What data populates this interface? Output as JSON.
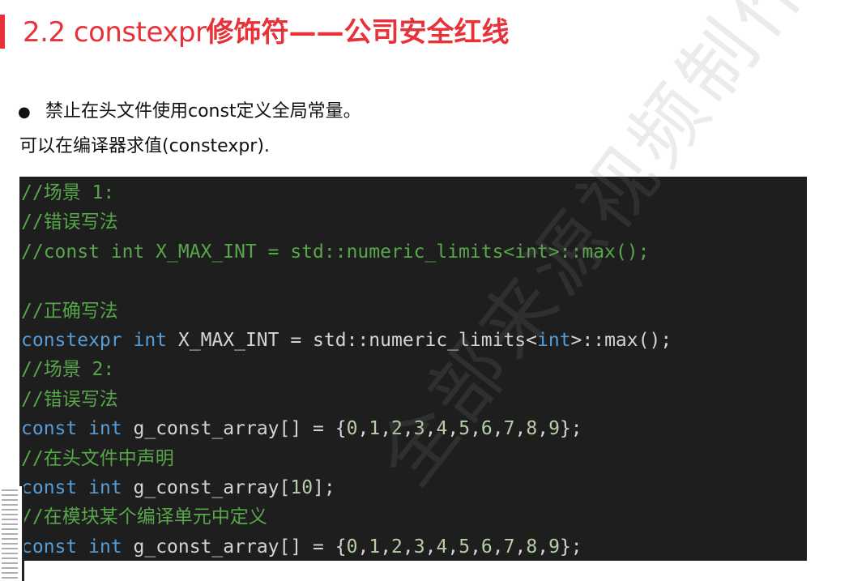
{
  "slide": {
    "title_prefix": "2.2  constexpr",
    "title_suffix": "修饰符——公司安全红线",
    "bullet_symbol": "●",
    "bullet_text": "禁止在头文件使用const定义全局常量。",
    "plain_text": "可以在编译器求值(constexpr).",
    "watermark": "全部来源视频制作",
    "accent_color": "#e8323a"
  },
  "code": {
    "language": "C++",
    "colors": {
      "background": "#1e1e1e",
      "comment": "#57a64a",
      "keyword": "#569cd6",
      "plain": "#d4d4d4",
      "number": "#b5cea8"
    },
    "lines": [
      [
        {
          "t": "//场景 1:",
          "c": "comment"
        }
      ],
      [
        {
          "t": "//错误写法",
          "c": "comment"
        }
      ],
      [
        {
          "t": "//const int X_MAX_INT = std::numeric_limits<int>::max();",
          "c": "comment"
        }
      ],
      [],
      [
        {
          "t": "//正确写法",
          "c": "comment"
        }
      ],
      [
        {
          "t": "constexpr",
          "c": "keyword"
        },
        {
          "t": " ",
          "c": "plain"
        },
        {
          "t": "int",
          "c": "keyword"
        },
        {
          "t": " X_MAX_INT = std::numeric_limits<",
          "c": "plain"
        },
        {
          "t": "int",
          "c": "keyword"
        },
        {
          "t": ">::max();",
          "c": "plain"
        }
      ],
      [
        {
          "t": "//场景 2:",
          "c": "comment"
        }
      ],
      [
        {
          "t": "//错误写法",
          "c": "comment"
        }
      ],
      [
        {
          "t": "const",
          "c": "keyword"
        },
        {
          "t": " ",
          "c": "plain"
        },
        {
          "t": "int",
          "c": "keyword"
        },
        {
          "t": " g_const_array[] = {",
          "c": "plain"
        },
        {
          "t": "0",
          "c": "number"
        },
        {
          "t": ",",
          "c": "plain"
        },
        {
          "t": "1",
          "c": "number"
        },
        {
          "t": ",",
          "c": "plain"
        },
        {
          "t": "2",
          "c": "number"
        },
        {
          "t": ",",
          "c": "plain"
        },
        {
          "t": "3",
          "c": "number"
        },
        {
          "t": ",",
          "c": "plain"
        },
        {
          "t": "4",
          "c": "number"
        },
        {
          "t": ",",
          "c": "plain"
        },
        {
          "t": "5",
          "c": "number"
        },
        {
          "t": ",",
          "c": "plain"
        },
        {
          "t": "6",
          "c": "number"
        },
        {
          "t": ",",
          "c": "plain"
        },
        {
          "t": "7",
          "c": "number"
        },
        {
          "t": ",",
          "c": "plain"
        },
        {
          "t": "8",
          "c": "number"
        },
        {
          "t": ",",
          "c": "plain"
        },
        {
          "t": "9",
          "c": "number"
        },
        {
          "t": "};",
          "c": "plain"
        }
      ],
      [
        {
          "t": "//在头文件中声明",
          "c": "comment"
        }
      ],
      [
        {
          "t": "const",
          "c": "keyword"
        },
        {
          "t": " ",
          "c": "plain"
        },
        {
          "t": "int",
          "c": "keyword"
        },
        {
          "t": " g_const_array[",
          "c": "plain"
        },
        {
          "t": "10",
          "c": "number"
        },
        {
          "t": "];",
          "c": "plain"
        }
      ],
      [
        {
          "t": "//在模块某个编译单元中定义",
          "c": "comment"
        }
      ],
      [
        {
          "t": "const",
          "c": "keyword"
        },
        {
          "t": " ",
          "c": "plain"
        },
        {
          "t": "int",
          "c": "keyword"
        },
        {
          "t": " g_const_array[] = {",
          "c": "plain"
        },
        {
          "t": "0",
          "c": "number"
        },
        {
          "t": ",",
          "c": "plain"
        },
        {
          "t": "1",
          "c": "number"
        },
        {
          "t": ",",
          "c": "plain"
        },
        {
          "t": "2",
          "c": "number"
        },
        {
          "t": ",",
          "c": "plain"
        },
        {
          "t": "3",
          "c": "number"
        },
        {
          "t": ",",
          "c": "plain"
        },
        {
          "t": "4",
          "c": "number"
        },
        {
          "t": ",",
          "c": "plain"
        },
        {
          "t": "5",
          "c": "number"
        },
        {
          "t": ",",
          "c": "plain"
        },
        {
          "t": "6",
          "c": "number"
        },
        {
          "t": ",",
          "c": "plain"
        },
        {
          "t": "7",
          "c": "number"
        },
        {
          "t": ",",
          "c": "plain"
        },
        {
          "t": "8",
          "c": "number"
        },
        {
          "t": ",",
          "c": "plain"
        },
        {
          "t": "9",
          "c": "number"
        },
        {
          "t": "};",
          "c": "plain"
        }
      ]
    ]
  }
}
